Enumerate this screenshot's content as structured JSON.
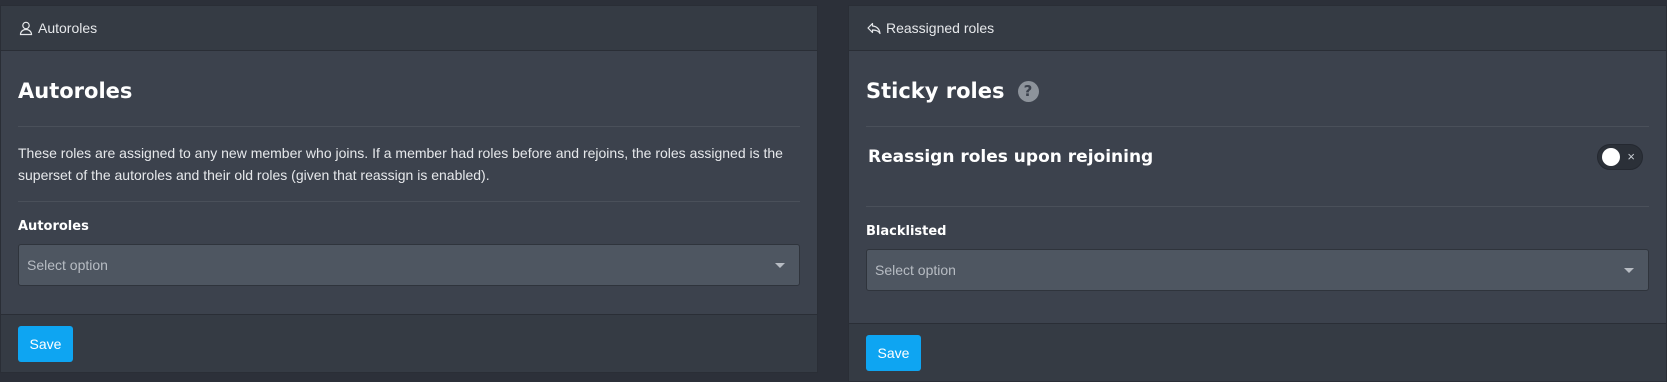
{
  "autoroles_card": {
    "header_label": "Autoroles",
    "header_icon": "user-icon",
    "title": "Autoroles",
    "description": "These roles are assigned to any new member who joins. If a member had roles before and rejoins, the roles assigned is the superset of the autoroles and their old roles (given that reassign is enabled).",
    "field_label": "Autoroles",
    "select_placeholder": "Select option",
    "save_label": "Save"
  },
  "reassigned_card": {
    "header_label": "Reassigned roles",
    "header_icon": "reply-arrow-icon",
    "title": "Sticky roles",
    "help_glyph": "?",
    "toggle_label": "Reassign roles upon rejoining",
    "toggle_state": "off",
    "toggle_off_glyph": "×",
    "field_label": "Blacklisted",
    "select_placeholder": "Select option",
    "save_label": "Save"
  },
  "colors": {
    "accent": "#0ea5f2",
    "card_bg": "#3c424d",
    "page_bg": "#2c3039",
    "select_bg": "#4e5661"
  }
}
